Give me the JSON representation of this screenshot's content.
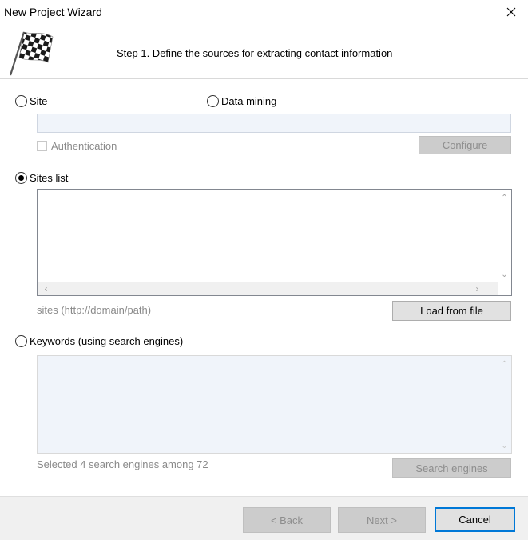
{
  "window": {
    "title": "New Project Wizard"
  },
  "header": {
    "step_title": "Step 1. Define the sources for extracting contact information"
  },
  "site_option": {
    "site_label": "Site",
    "data_mining_label": "Data mining",
    "url_value": "",
    "authentication_label": "Authentication",
    "configure_label": "Configure"
  },
  "sites_list_option": {
    "label": "Sites list",
    "hint": "sites (http://domain/path)",
    "load_from_file_label": "Load from file"
  },
  "keywords_option": {
    "label": "Keywords (using search engines)",
    "hint": "Selected 4 search engines among 72",
    "search_engines_label": "Search engines"
  },
  "footer": {
    "back_label": "< Back",
    "next_label": "Next >",
    "cancel_label": "Cancel"
  }
}
